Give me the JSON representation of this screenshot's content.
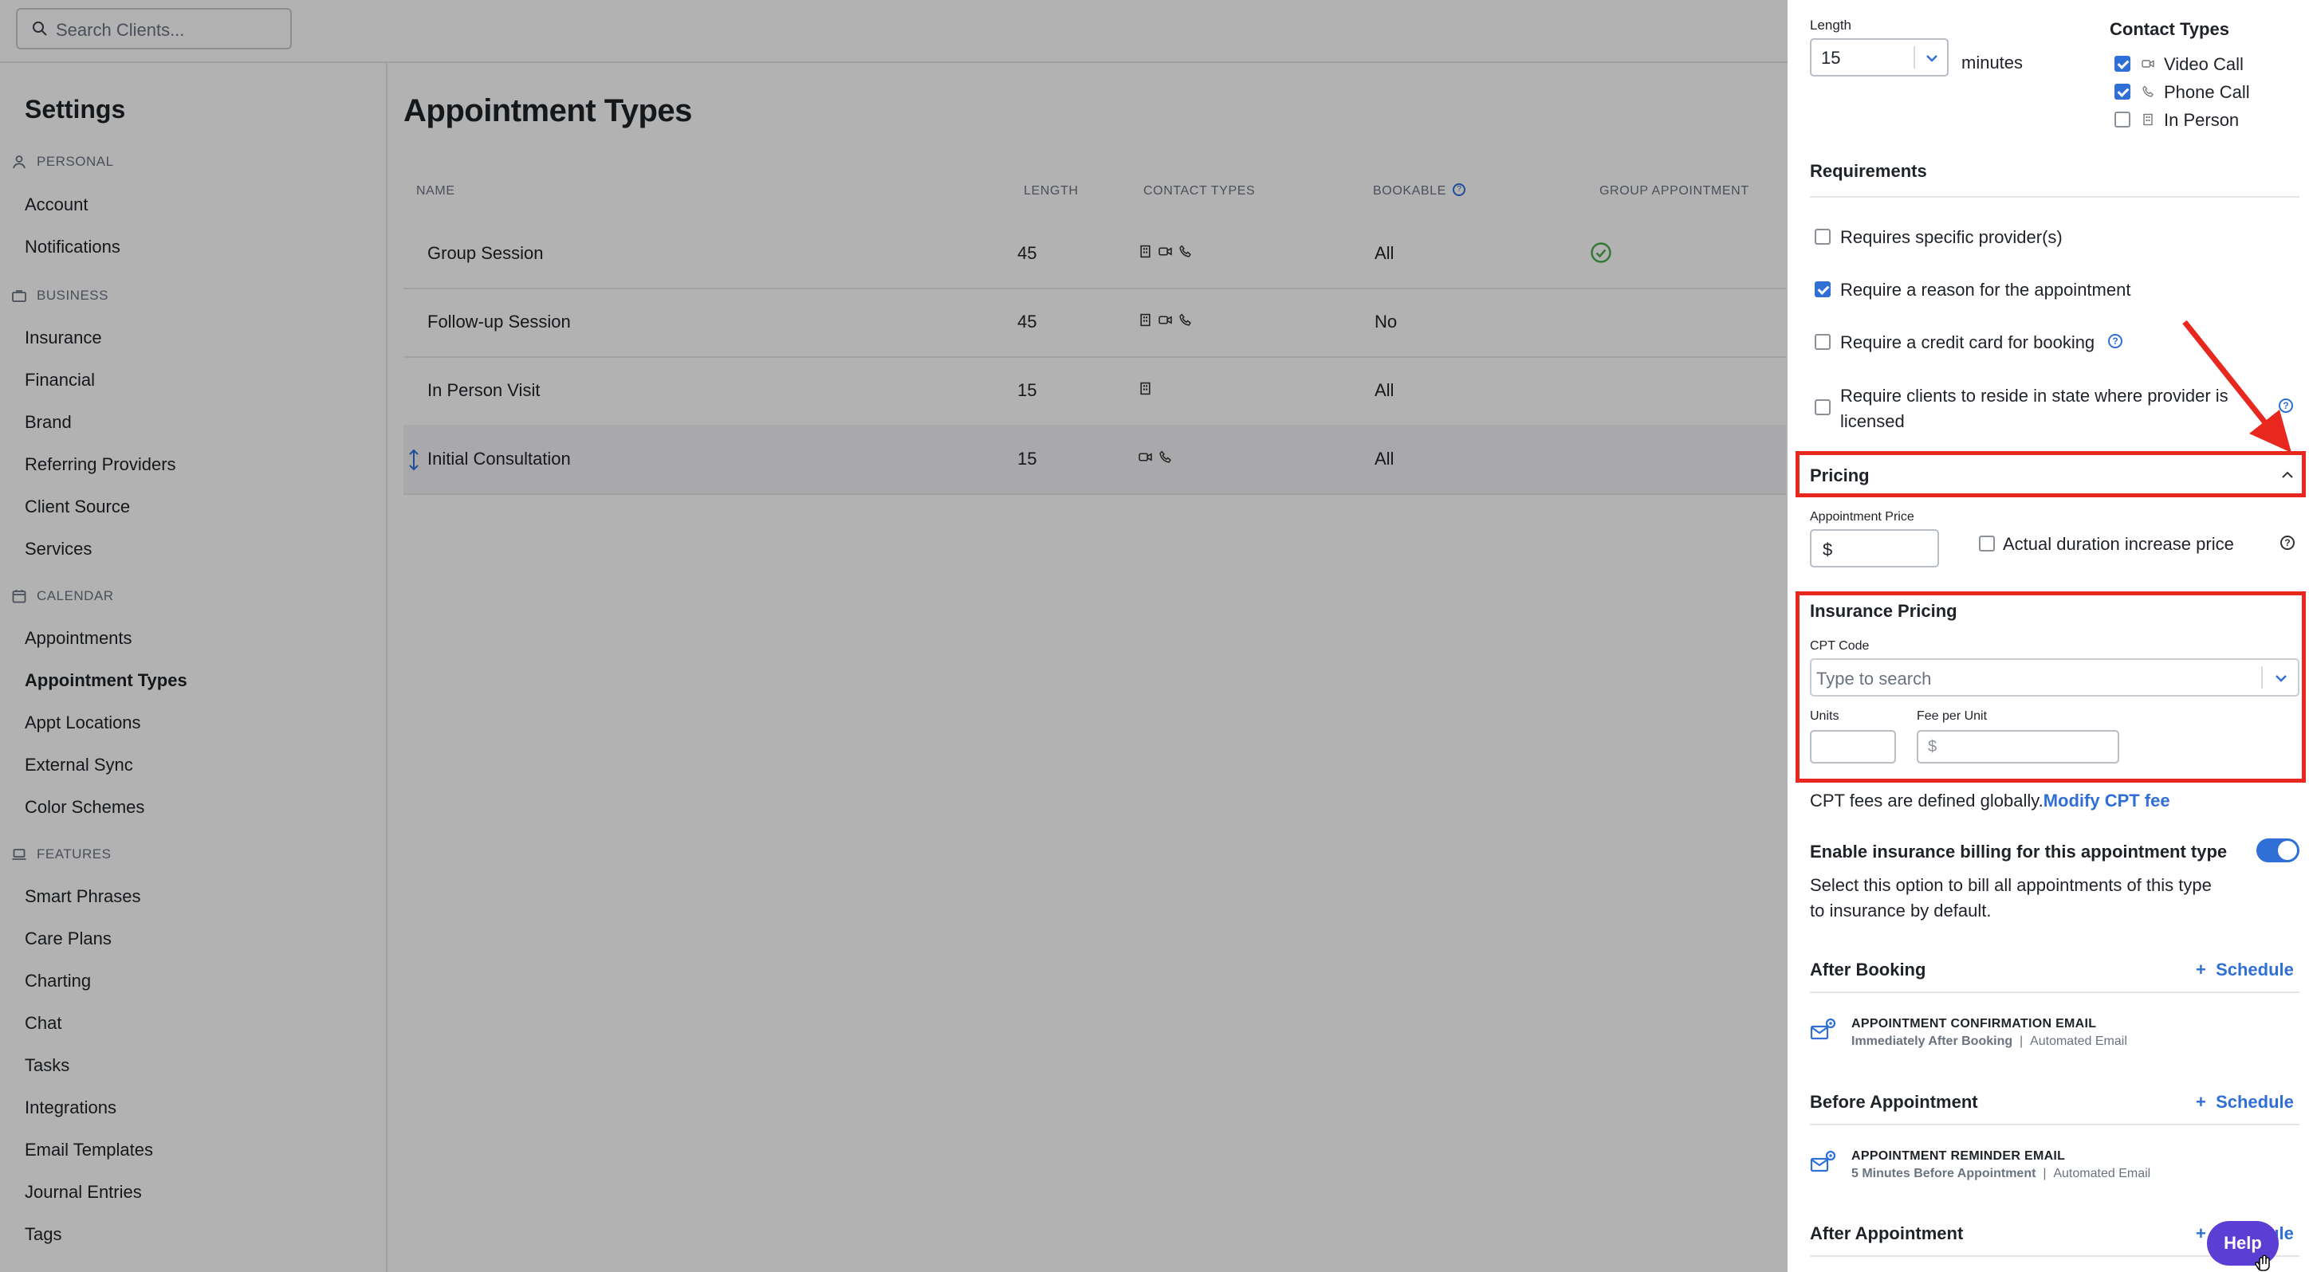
{
  "search": {
    "placeholder": "Search Clients..."
  },
  "sidebar": {
    "title": "Settings",
    "sections": [
      {
        "label": "PERSONAL",
        "items": [
          "Account",
          "Notifications"
        ]
      },
      {
        "label": "BUSINESS",
        "items": [
          "Insurance",
          "Financial",
          "Brand",
          "Referring Providers",
          "Client Source",
          "Services"
        ]
      },
      {
        "label": "CALENDAR",
        "items": [
          "Appointments",
          "Appointment Types",
          "Appt Locations",
          "External Sync",
          "Color Schemes"
        ]
      },
      {
        "label": "FEATURES",
        "items": [
          "Smart Phrases",
          "Care Plans",
          "Charting",
          "Chat",
          "Tasks",
          "Integrations",
          "Email Templates",
          "Journal Entries",
          "Tags"
        ]
      }
    ],
    "active_item": "Appointment Types"
  },
  "main": {
    "title": "Appointment Types",
    "columns": [
      "NAME",
      "LENGTH",
      "CONTACT TYPES",
      "BOOKABLE",
      "GROUP APPOINTMENT"
    ],
    "rows": [
      {
        "name": "Group Session",
        "length": "45",
        "contact_icons": [
          "building-icon",
          "video-icon",
          "phone-icon"
        ],
        "bookable": "All",
        "group": true
      },
      {
        "name": "Follow-up Session",
        "length": "45",
        "contact_icons": [
          "building-icon",
          "video-icon",
          "phone-icon"
        ],
        "bookable": "No",
        "group": false
      },
      {
        "name": "In Person Visit",
        "length": "15",
        "contact_icons": [
          "building-icon"
        ],
        "bookable": "All",
        "group": false
      },
      {
        "name": "Initial Consultation",
        "length": "15",
        "contact_icons": [
          "video-icon",
          "phone-icon"
        ],
        "bookable": "All",
        "group": false,
        "selected": true
      }
    ]
  },
  "drawer": {
    "length_label": "Length",
    "length_value": "15",
    "length_unit": "minutes",
    "contact_types_title": "Contact Types",
    "contact_types": [
      {
        "label": "Video Call",
        "checked": true
      },
      {
        "label": "Phone Call",
        "checked": true
      },
      {
        "label": "In Person",
        "checked": false
      }
    ],
    "requirements_title": "Requirements",
    "requirements": [
      {
        "label": "Requires specific provider(s)",
        "checked": false
      },
      {
        "label": "Require a reason for the appointment",
        "checked": true
      },
      {
        "label": "Require a credit card for booking",
        "checked": false
      },
      {
        "label_line1": "Require clients to reside in state where provider is",
        "label_line2": "licensed",
        "checked": false
      }
    ],
    "pricing_title": "Pricing",
    "appointment_price_label": "Appointment Price",
    "currency_symbol": "$",
    "actual_duration_label": "Actual duration increase price",
    "actual_duration_checked": false,
    "insurance_pricing_title": "Insurance Pricing",
    "cpt_code_label": "CPT Code",
    "cpt_placeholder": "Type to search",
    "units_label": "Units",
    "fee_per_unit_label": "Fee per Unit",
    "fee_placeholder": "$",
    "cpt_note": "CPT fees are defined globally.",
    "modify_cpt_link": "Modify CPT fee",
    "insurance_billing_title": "Enable insurance billing for this appointment type",
    "insurance_billing_on": true,
    "insurance_billing_desc_line1": "Select this option to bill all appointments of this type",
    "insurance_billing_desc_line2": "to insurance by default.",
    "after_booking": {
      "title": "After Booking",
      "action": "Schedule",
      "email_name": "APPOINTMENT CONFIRMATION EMAIL",
      "email_timing": "Immediately After Booking",
      "email_type": "Automated Email"
    },
    "before_appointment": {
      "title": "Before Appointment",
      "action": "Schedule",
      "email_name": "APPOINTMENT REMINDER EMAIL",
      "email_timing": "5 Minutes Before Appointment",
      "email_type": "Automated Email"
    },
    "after_appointment": {
      "title": "After Appointment",
      "action": "Schedule"
    },
    "help_button": "Help"
  },
  "colors": {
    "accent": "#2f6fd6",
    "annotation_red": "#e8271f",
    "check_green": "#4caf50"
  }
}
